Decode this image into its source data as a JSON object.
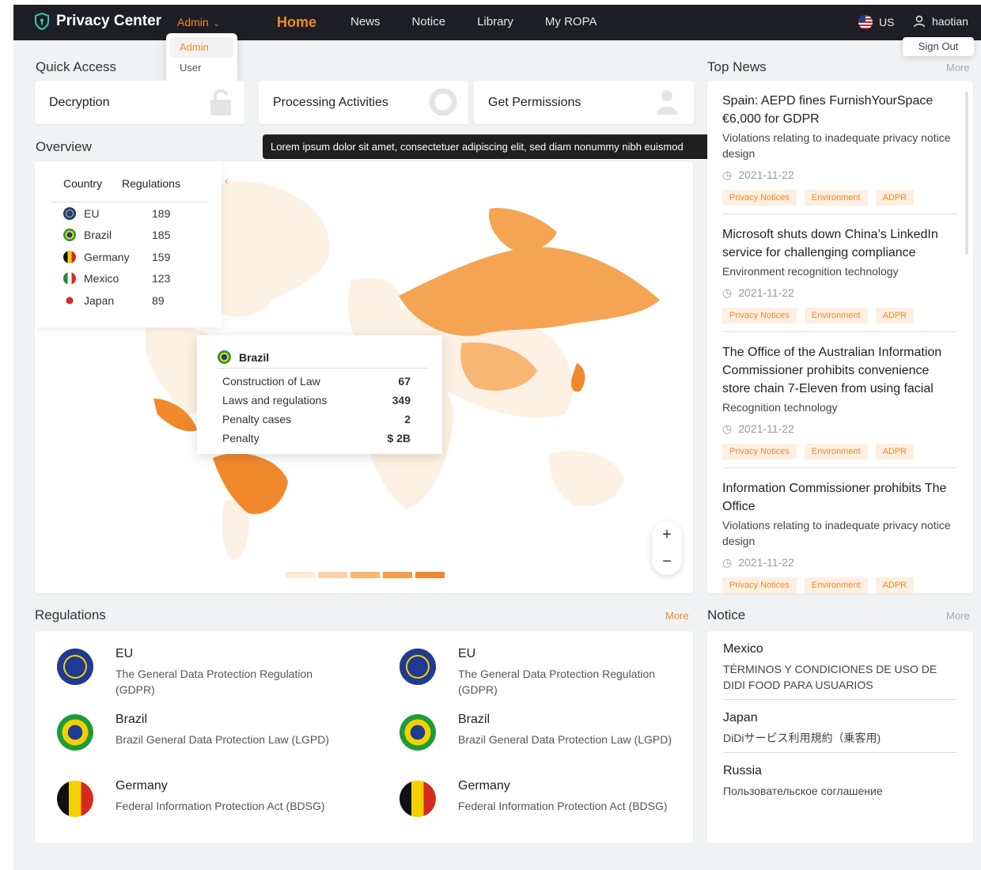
{
  "header": {
    "brand": "Privacy Center",
    "role": "Admin",
    "role_options": [
      "Admin",
      "User"
    ],
    "nav": [
      "Home",
      "News",
      "Notice",
      "Library",
      "My ROPA"
    ],
    "active_nav": "Home",
    "region": "US",
    "user": "haotian",
    "signout": "Sign Out"
  },
  "quick_access": {
    "title": "Quick Access",
    "items": [
      "Decryption",
      "Processing Activities",
      "Get Permissions"
    ],
    "tooltip": "Lorem ipsum dolor sit amet, consectetuer adipiscing elit, sed diam nonummy nibh euismod"
  },
  "overview": {
    "title": "Overview",
    "table": {
      "headers": [
        "Country",
        "Regulations"
      ],
      "rows": [
        {
          "country": "EU",
          "count": "189"
        },
        {
          "country": "Brazil",
          "count": "185"
        },
        {
          "country": "Germany",
          "count": "159"
        },
        {
          "country": "Mexico",
          "count": "123"
        },
        {
          "country": "Japan",
          "count": "89"
        }
      ]
    },
    "popup": {
      "country": "Brazil",
      "rows": [
        {
          "label": "Construction of Law",
          "value": "67"
        },
        {
          "label": "Laws and regulations",
          "value": "349"
        },
        {
          "label": "Penalty cases",
          "value": "2"
        },
        {
          "label": "Penalty",
          "value": "$ 2B"
        }
      ]
    },
    "zoom_in": "+",
    "zoom_out": "−",
    "legend_colors": [
      "#fde9d6",
      "#fbd1a8",
      "#f8b673",
      "#f59d48",
      "#f0892b"
    ]
  },
  "top_news": {
    "title": "Top News",
    "more": "More",
    "items": [
      {
        "title": "Spain: AEPD fines FurnishYourSpace €6,000 for GDPR",
        "desc": "Violations relating to inadequate privacy notice design",
        "date": "2021-11-22",
        "tags": [
          "Privacy Notices",
          "Environment",
          "ADPR"
        ]
      },
      {
        "title": "Microsoft shuts down China’s LinkedIn service for challenging compliance",
        "desc": "Environment recognition technology",
        "date": "2021-11-22",
        "tags": [
          "Privacy Notices",
          "Environment",
          "ADPR"
        ]
      },
      {
        "title": "The Office of the Australian Information Commissioner prohibits convenience store chain 7-Eleven from using facial",
        "desc": "Recognition technology",
        "date": "2021-11-22",
        "tags": [
          "Privacy Notices",
          "Environment",
          "ADPR"
        ]
      },
      {
        "title": "Information Commissioner prohibits The Office",
        "desc": "Violations relating to inadequate privacy notice design",
        "date": "2021-11-22",
        "tags": [
          "Privacy Notices",
          "Environment",
          "ADPR"
        ]
      }
    ]
  },
  "regulations": {
    "title": "Regulations",
    "more": "More",
    "items": [
      {
        "name": "EU",
        "desc": "The General Data Protection Regulation (GDPR)"
      },
      {
        "name": "EU",
        "desc": "The General Data Protection Regulation (GDPR)"
      },
      {
        "name": "Brazil",
        "desc": "Brazil General Data Protection Law (LGPD)"
      },
      {
        "name": "Brazil",
        "desc": "Brazil General Data Protection Law (LGPD)"
      },
      {
        "name": "Germany",
        "desc": "Federal Information Protection Act (BDSG)"
      },
      {
        "name": "Germany",
        "desc": "Federal Information Protection Act (BDSG)"
      }
    ]
  },
  "notice": {
    "title": "Notice",
    "more": "More",
    "items": [
      {
        "country": "Mexico",
        "text": "TÉRMINOS Y CONDICIONES DE USO DE DIDI FOOD PARA USUARIOS"
      },
      {
        "country": "Japan",
        "text": "DiDiサービス利用規約（乗客用)"
      },
      {
        "country": "Russia",
        "text": "Пользовательское соглашение"
      }
    ]
  },
  "colors": {
    "accent": "#f0892b",
    "topbar": "#1d1f24",
    "background": "#f1f2f4"
  }
}
